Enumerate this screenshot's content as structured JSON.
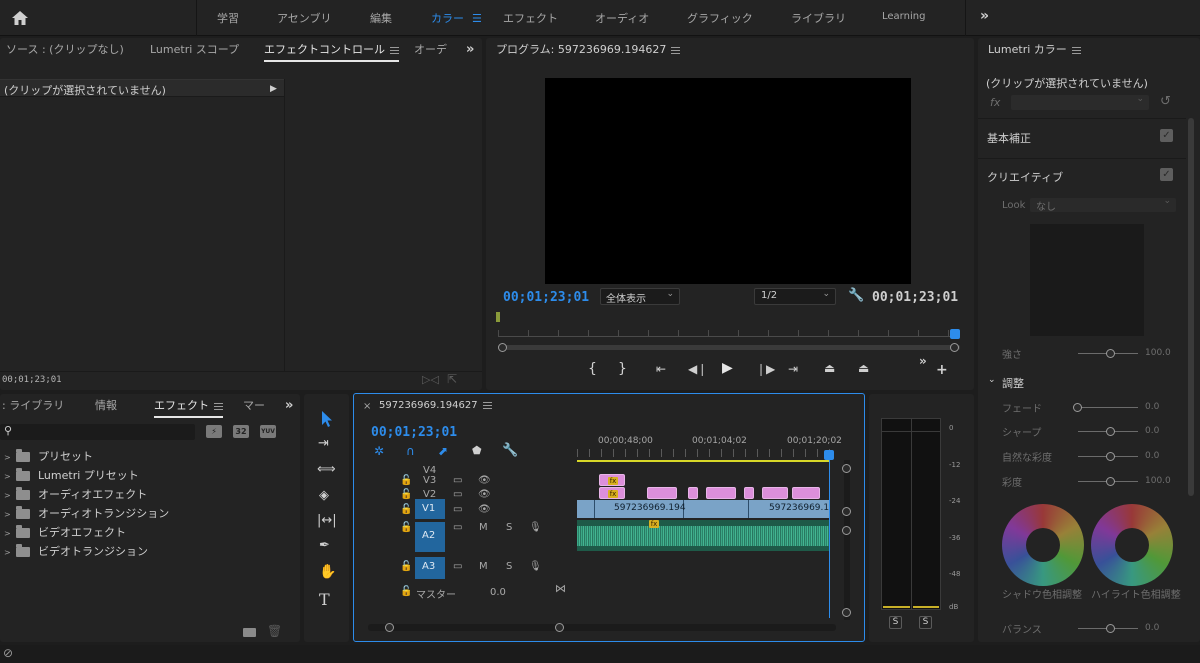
{
  "topbar": {
    "workspaces": [
      "学習",
      "アセンブリ",
      "編集",
      "カラー",
      "エフェクト",
      "オーディオ",
      "グラフィック",
      "ライブラリ",
      "Learning"
    ],
    "active_index": 3,
    "more": "»"
  },
  "source_panel": {
    "tabs": [
      "ソース : (クリップなし)",
      "Lumetri スコープ",
      "エフェクトコントロール",
      "オーデ"
    ],
    "active_tab": 2,
    "clip_message": "(クリップが選択されていません)",
    "timecode": "00;01;23;01"
  },
  "program_monitor": {
    "title": "プログラム: 597236969.194627",
    "timecode_left": "00;01;23;01",
    "zoom": "全体表示",
    "resolution": "1/2",
    "timecode_right": "00;01;23;01"
  },
  "lumetri": {
    "title": "Lumetri カラー",
    "clip_message": "(クリップが選択されていません)",
    "fx_label": "fx",
    "basic": "基本補正",
    "creative": "クリエイティブ",
    "look_label": "Look",
    "look_value": "なし",
    "intensity_label": "強さ",
    "intensity_value": "100.0",
    "adjust_header": "調整",
    "sliders": [
      {
        "label": "フェード",
        "value": "0.0",
        "pos": 0.0
      },
      {
        "label": "シャープ",
        "value": "0.0",
        "pos": 0.5
      },
      {
        "label": "自然な彩度",
        "value": "0.0",
        "pos": 0.5
      },
      {
        "label": "彩度",
        "value": "100.0",
        "pos": 0.5
      }
    ],
    "wheel_labels": [
      "シャドウ色相調整",
      "ハイライト色相調整"
    ],
    "balance_label": "バランス",
    "balance_value": "0.0"
  },
  "effects_panel": {
    "tabs": [
      "ライブラリ",
      "情報",
      "エフェクト",
      "マー"
    ],
    "active_tab": 2,
    "search_placeholder": "",
    "badges": [
      "32",
      "YUV"
    ],
    "items": [
      "プリセット",
      "Lumetri プリセット",
      "オーディオエフェクト",
      "オーディオトランジション",
      "ビデオエフェクト",
      "ビデオトランジション"
    ]
  },
  "timeline": {
    "title": "597236969.194627",
    "timecode": "00;01;23;01",
    "ruler": [
      "00;00;48;00",
      "00;01;04;02",
      "00;01;20;02"
    ],
    "video_tracks": [
      "V4",
      "V3",
      "V2",
      "V1"
    ],
    "audio_tracks": [
      "A2",
      "A3"
    ],
    "master_label": "マスター",
    "master_value": "0.0",
    "clip_name_1": "597236969.194",
    "clip_name_2": "597236969.1",
    "m_label": "M",
    "s_label": "S"
  },
  "meter": {
    "scale": [
      "0",
      "-12",
      "-24",
      "-36",
      "-48",
      "dB"
    ],
    "solo": [
      "S",
      "S"
    ]
  },
  "colors": {
    "accent": "#2d8ceb",
    "clip_video": "#7aa3c7",
    "clip_pink": "#dc8fdb",
    "audio": "#2f9e7c",
    "panel": "#232323"
  }
}
